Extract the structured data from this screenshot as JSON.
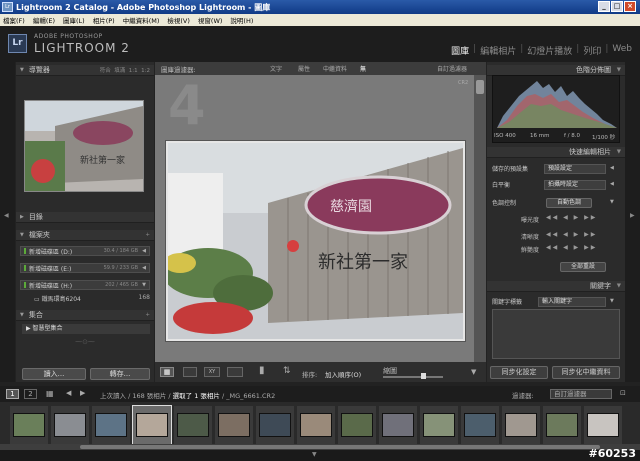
{
  "window": {
    "title": "Lightroom 2 Catalog - Adobe Photoshop Lightroom - 圖庫",
    "app_icon": "Lr",
    "buttons": [
      "_",
      "□",
      "×"
    ]
  },
  "menu": [
    "檔案(F)",
    "編輯(E)",
    "圖庫(L)",
    "相片(P)",
    "中繼資料(M)",
    "檢視(V)",
    "視窗(W)",
    "說明(H)"
  ],
  "identity": {
    "logo": "Lr",
    "adobe": "ADOBE PHOTOSHOP",
    "product": "LIGHTROOM 2",
    "modules": [
      "圖庫",
      "編輯相片",
      "幻燈片播放",
      "列印",
      "Web"
    ],
    "active_module": "圖庫"
  },
  "left": {
    "navigator": {
      "title": "導覽器",
      "zoom": [
        "符合",
        "填滿",
        "1:1",
        "1:2"
      ]
    },
    "catalog": {
      "title": "目錄"
    },
    "folders": {
      "title": "檔案夾",
      "items": [
        {
          "label": "新增磁碟區 (D:)",
          "capacity": "30.4 / 184 GB"
        },
        {
          "label": "新增磁碟區 (E:)",
          "capacity": "59.9 / 233 GB"
        },
        {
          "label": "新增磁碟區 (H:)",
          "capacity": "202 / 465 GB"
        }
      ],
      "subfolder": {
        "label": "鐵馬環島6204",
        "count": "168"
      }
    },
    "collections": {
      "title": "集合",
      "items": [
        "智慧型集合"
      ]
    },
    "buttons": {
      "import": "讀入...",
      "export": "轉存..."
    }
  },
  "center": {
    "filter_label": "圖庫過濾器:",
    "filters": [
      "文字",
      "屬性",
      "中繼資料",
      "無"
    ],
    "filter_preset": "自訂過濾器",
    "cell_number": "4",
    "badge": "CR2",
    "toolbar": {
      "sort_label": "排序:",
      "sort_value": "加入順序(O)",
      "thumb_label": "縮圖"
    }
  },
  "right": {
    "histogram": {
      "title": "色階分佈圖",
      "iso": "ISO 400",
      "focal": "16 mm",
      "aperture": "f / 8.0",
      "shutter": "1/100 秒"
    },
    "quick_develop": {
      "title": "快速編輯相片",
      "preset_label": "儲存的預設集",
      "preset_value": "預設設定",
      "wb_label": "白平衡",
      "wb_value": "拍攝時設定",
      "tone_label": "色調控制",
      "auto_button": "自動色調",
      "sliders": [
        "曝光度",
        "清晰度",
        "鮮艷度"
      ],
      "reset_button": "全部重設"
    },
    "keywording": {
      "title": "關鍵字",
      "tags_label": "關鍵字標籤",
      "tags_value": "輸入關鍵字"
    },
    "sync_metadata": "同步化設定",
    "sync_settings": "同步化中繼資料"
  },
  "filmstrip": {
    "page_buttons": [
      "1",
      "2"
    ],
    "path_prev": "上次讀入 / 168 張相片 /",
    "path_selected": "選取了 1 張相片",
    "path_file": "/ _MG_6661.CR2",
    "filter_label": "過濾器:",
    "filter_value": "自訂過濾器",
    "thumb_count": 15
  },
  "watermark": "#60253",
  "colors": {
    "accent": "#0a5a94",
    "panel": "#2b2b2b",
    "active_text": "#f0f0f0",
    "title_blue": "#2a5aa8"
  }
}
